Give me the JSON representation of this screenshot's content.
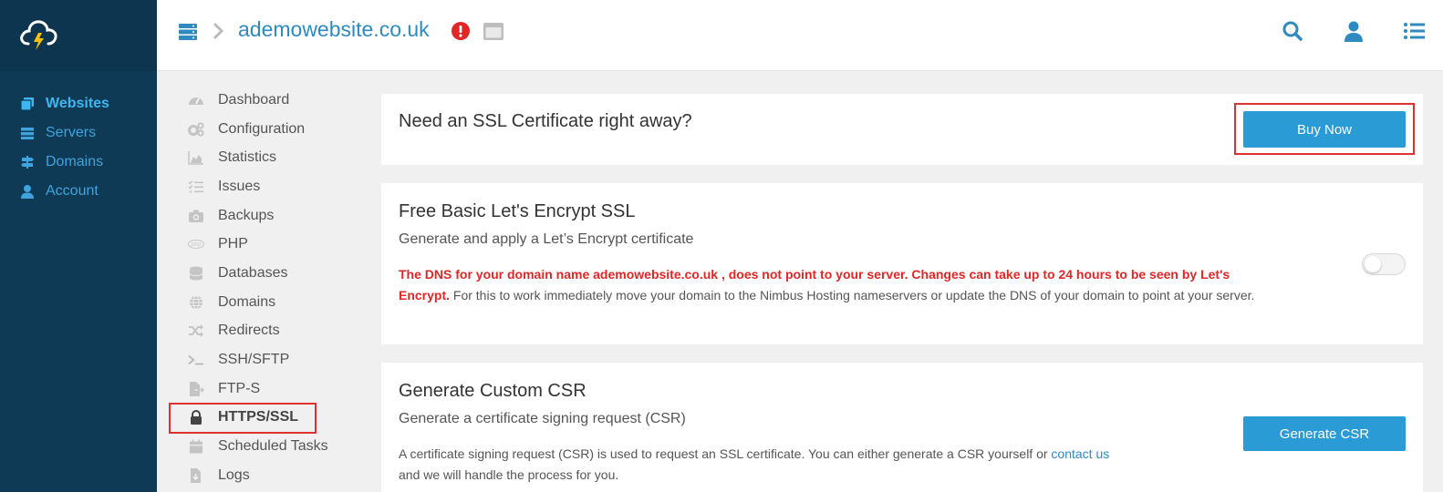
{
  "app_nav": {
    "items": [
      {
        "label": "Websites",
        "icon": "websites-icon",
        "active": true
      },
      {
        "label": "Servers",
        "icon": "servers-icon",
        "active": false
      },
      {
        "label": "Domains",
        "icon": "domains-icon",
        "active": false
      },
      {
        "label": "Account",
        "icon": "account-icon",
        "active": false
      }
    ]
  },
  "header": {
    "site_name": "ademowebsite.co.uk",
    "icons": [
      "server-icon",
      "chevron-right-icon",
      "alert-icon",
      "window-icon",
      "search-icon",
      "user-icon",
      "list-icon"
    ]
  },
  "section_nav": {
    "items": [
      {
        "label": "Dashboard",
        "icon": "dashboard-icon"
      },
      {
        "label": "Configuration",
        "icon": "cogs-icon"
      },
      {
        "label": "Statistics",
        "icon": "area-chart-icon"
      },
      {
        "label": "Issues",
        "icon": "tasks-icon"
      },
      {
        "label": "Backups",
        "icon": "camera-icon"
      },
      {
        "label": "PHP",
        "icon": "php-icon"
      },
      {
        "label": "Databases",
        "icon": "database-icon"
      },
      {
        "label": "Domains",
        "icon": "globe-icon"
      },
      {
        "label": "Redirects",
        "icon": "random-icon"
      },
      {
        "label": "SSH/SFTP",
        "icon": "terminal-icon"
      },
      {
        "label": "FTP-S",
        "icon": "file-export-icon"
      },
      {
        "label": "HTTPS/SSL",
        "icon": "lock-icon"
      },
      {
        "label": "Scheduled Tasks",
        "icon": "calendar-icon"
      },
      {
        "label": "Logs",
        "icon": "file-download-icon"
      }
    ]
  },
  "cards": {
    "ssl_offer": {
      "title": "Need an SSL Certificate right away?",
      "button": "Buy Now"
    },
    "letsencrypt": {
      "title": "Free Basic Let's Encrypt SSL",
      "subtitle": "Generate and apply a Let’s Encrypt certificate",
      "warning": "The DNS for your domain name ademowebsite.co.uk , does not point to your server. Changes can take up to 24 hours to be seen by Let's Encrypt.",
      "info": " For this to work immediately move your domain to the Nimbus Hosting nameservers or update the DNS of your domain to point at your server.",
      "toggle_on": false
    },
    "csr": {
      "title": "Generate Custom CSR",
      "subtitle": "Generate a certificate signing request (CSR)",
      "body_pre": "A certificate signing request (CSR) is used to request an SSL certificate. You can either generate a CSR yourself or ",
      "link": "contact us",
      "body_post": "and we will handle the process for you.",
      "button": "Generate CSR"
    }
  },
  "colors": {
    "nav_bg": "#0e3a56",
    "accent": "#2b9bd6",
    "highlight": "#e03131",
    "warning": "#e02626"
  }
}
